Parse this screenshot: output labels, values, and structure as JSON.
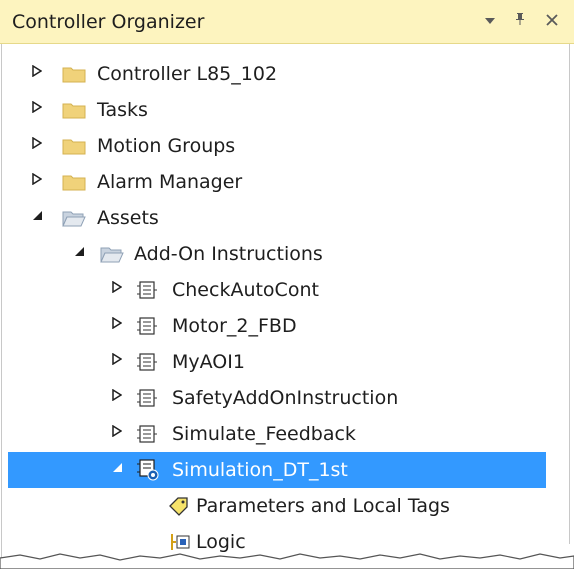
{
  "panel": {
    "title": "Controller Organizer",
    "buttons": {
      "dropdown": "▼",
      "pin": "ᵖ",
      "close": "✕"
    }
  },
  "tree": {
    "controller": "Controller L85_102",
    "tasks": "Tasks",
    "motion_groups": "Motion Groups",
    "alarm_manager": "Alarm Manager",
    "assets": "Assets",
    "add_on_instructions": "Add-On Instructions",
    "aoi_items": [
      "CheckAutoCont",
      "Motor_2_FBD",
      "MyAOI1",
      "SafetyAddOnInstruction",
      "Simulate_Feedback"
    ],
    "selected_aoi": "Simulation_DT_1st",
    "params": "Parameters and Local Tags",
    "logic": "Logic"
  },
  "colors": {
    "titlebar": "#fdf4bf",
    "selection": "#3399ff",
    "folder": "#f0d27a",
    "folder_open": "#c9d3df"
  },
  "icons": {
    "collapsed": "triangle-right-icon",
    "expanded": "triangle-down-icon",
    "folder": "folder-icon",
    "aoi": "aoi-instruction-icon",
    "tag": "tag-icon",
    "logic": "logic-icon"
  }
}
